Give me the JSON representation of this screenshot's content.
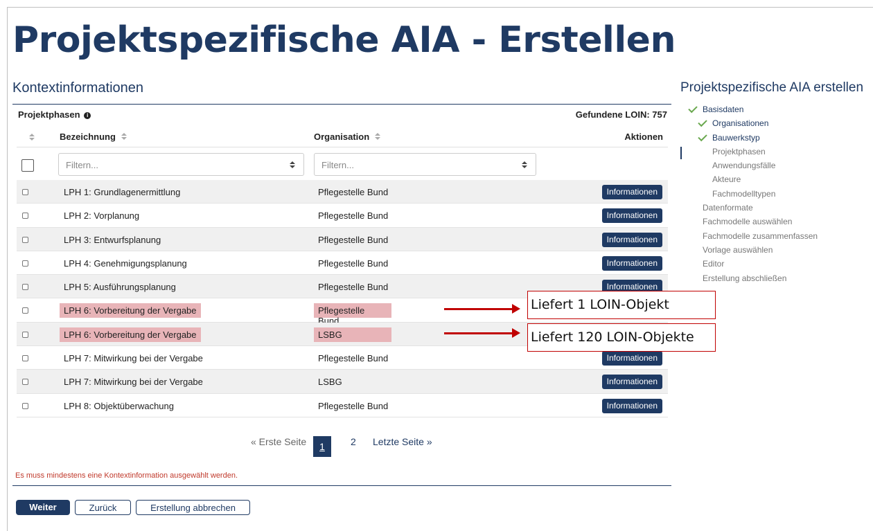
{
  "page_title": "Projektspezifische AIA - Erstellen",
  "section_title": "Kontextinformationen",
  "phases_label": "Projektphasen",
  "found_count": "Gefundene LOIN: 757",
  "columns": {
    "bezeichnung": "Bezeichnung",
    "organisation": "Organisation",
    "aktionen": "Aktionen"
  },
  "filter": {
    "bezeichnung_placeholder": "Filtern...",
    "organisation_placeholder": "Filtern..."
  },
  "rows": [
    {
      "bezeichnung": "LPH 1: Grundlagenermittlung",
      "organisation": "Pflegestelle Bund",
      "action": "Informationen",
      "highlighted": false
    },
    {
      "bezeichnung": "LPH 2: Vorplanung",
      "organisation": "Pflegestelle Bund",
      "action": "Informationen",
      "highlighted": false
    },
    {
      "bezeichnung": "LPH 3: Entwurfsplanung",
      "organisation": "Pflegestelle Bund",
      "action": "Informationen",
      "highlighted": false
    },
    {
      "bezeichnung": "LPH 4: Genehmigungsplanung",
      "organisation": "Pflegestelle Bund",
      "action": "Informationen",
      "highlighted": false
    },
    {
      "bezeichnung": "LPH 5: Ausführungsplanung",
      "organisation": "Pflegestelle Bund",
      "action": "Informationen",
      "highlighted": false
    },
    {
      "bezeichnung": "LPH 6: Vorbereitung der Vergabe",
      "organisation": "Pflegestelle Bund",
      "action": "",
      "highlighted": true
    },
    {
      "bezeichnung": "LPH 6: Vorbereitung der Vergabe",
      "organisation": "LSBG",
      "action": "",
      "highlighted": true
    },
    {
      "bezeichnung": "LPH 7: Mitwirkung bei der Vergabe",
      "organisation": "Pflegestelle Bund",
      "action": "Informationen",
      "highlighted": false
    },
    {
      "bezeichnung": "LPH 7: Mitwirkung bei der Vergabe",
      "organisation": "LSBG",
      "action": "Informationen",
      "highlighted": false
    },
    {
      "bezeichnung": "LPH 8: Objektüberwachung",
      "organisation": "Pflegestelle Bund",
      "action": "Informationen",
      "highlighted": false
    }
  ],
  "pagination": {
    "first": "« Erste Seite",
    "current": "1",
    "next": "2",
    "last": "Letzte Seite »"
  },
  "error_message": "Es muss mindestens eine Kontextinformation ausgewählt werden.",
  "buttons": {
    "weiter": "Weiter",
    "zurueck": "Zurück",
    "abbrechen": "Erstellung abbrechen"
  },
  "annotations": {
    "callout1": "Liefert 1 LOIN-Objekt",
    "callout2": "Liefert 120 LOIN-Objekte",
    "color": "#c00000"
  },
  "sidebar": {
    "title": "Projektspezifische AIA erstellen",
    "steps": [
      {
        "label": "Basisdaten",
        "level": 0,
        "done": true
      },
      {
        "label": "Organisationen",
        "level": 1,
        "done": true
      },
      {
        "label": "Bauwerkstyp",
        "level": 1,
        "done": true
      },
      {
        "label": "Projektphasen",
        "level": 1,
        "done": false
      },
      {
        "label": "Anwendungsfälle",
        "level": 1,
        "done": false
      },
      {
        "label": "Akteure",
        "level": 1,
        "done": false
      },
      {
        "label": "Fachmodelltypen",
        "level": 1,
        "done": false
      },
      {
        "label": "Datenformate",
        "level": 0,
        "done": false
      },
      {
        "label": "Fachmodelle auswählen",
        "level": 0,
        "done": false
      },
      {
        "label": "Fachmodelle zusammenfassen",
        "level": 0,
        "done": false
      },
      {
        "label": "Vorlage auswählen",
        "level": 0,
        "done": false
      },
      {
        "label": "Editor",
        "level": 0,
        "done": false
      },
      {
        "label": "Erstellung abschließen",
        "level": 0,
        "done": false
      }
    ]
  },
  "colors": {
    "primary": "#1f3a63",
    "highlight": "#e8b4b8",
    "check": "#6aa84f",
    "error": "#c0392b"
  }
}
